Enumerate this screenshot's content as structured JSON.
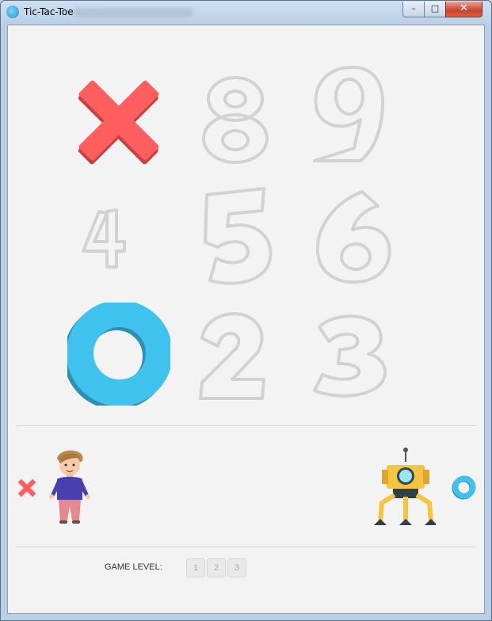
{
  "window": {
    "title": "Tic-Tac-Toe",
    "buttons": {
      "minimize": "–",
      "maximize": "□",
      "close": "✕"
    }
  },
  "colors": {
    "x_mark": "#ff5e5e",
    "o_mark": "#3fc3ee",
    "ghost_digit": "#d2d2d2",
    "background": "#f3f3f3"
  },
  "board": {
    "cells": [
      {
        "position": 7,
        "mark": "X"
      },
      {
        "position": 8,
        "mark": ""
      },
      {
        "position": 9,
        "mark": ""
      },
      {
        "position": 4,
        "mark": ""
      },
      {
        "position": 5,
        "mark": ""
      },
      {
        "position": 6,
        "mark": ""
      },
      {
        "position": 1,
        "mark": "O"
      },
      {
        "position": 2,
        "mark": ""
      },
      {
        "position": 3,
        "mark": ""
      }
    ]
  },
  "players": {
    "human": {
      "avatar": "boy-avatar-icon",
      "mark": "X"
    },
    "computer": {
      "avatar": "robot-avatar-icon",
      "mark": "O"
    }
  },
  "game_level": {
    "label": "GAME LEVEL:",
    "options": [
      "1",
      "2",
      "3"
    ]
  }
}
